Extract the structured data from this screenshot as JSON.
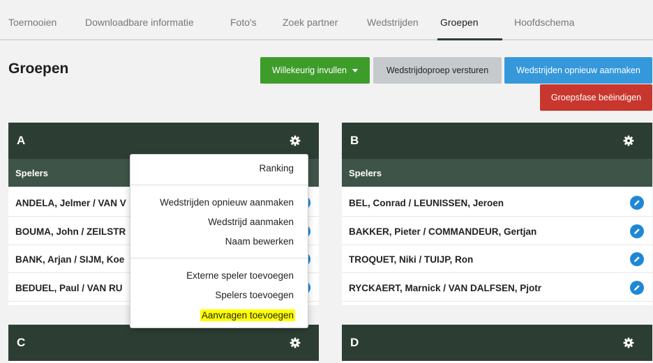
{
  "tabs": [
    {
      "label": "Toernooien"
    },
    {
      "label": "Downloadbare informatie"
    },
    {
      "label": "Foto's"
    },
    {
      "label": "Zoek partner"
    },
    {
      "label": "Wedstrijden"
    },
    {
      "label": "Groepen",
      "active": true
    },
    {
      "label": "Hoofdschema"
    }
  ],
  "page_title": "Groepen",
  "actions": {
    "random_fill": "Willekeurig invullen",
    "send_calls": "Wedstrijdoproep versturen",
    "recreate_matches": "Wedstrijden opnieuw aanmaken",
    "end_group_phase": "Groepsfase beëindigen"
  },
  "colors": {
    "dark_green": "#2c3e33",
    "green": "#3e9d2a",
    "blue": "#3598db",
    "red": "#c8372d",
    "grey": "#c6cacd",
    "highlight": "#ffff00"
  },
  "groups": [
    {
      "letter": "A",
      "players_header": "Spelers",
      "players": [
        "ANDELA, Jelmer / VAN V",
        "BOUMA, John / ZEILSTR",
        "BANK, Arjan / SIJM, Koe",
        "BEDUEL, Paul / VAN RU"
      ]
    },
    {
      "letter": "B",
      "players_header": "Spelers",
      "players": [
        "BEL, Conrad / LEUNISSEN, Jeroen",
        "BAKKER, Pieter / COMMANDEUR, Gertjan",
        "TROQUET, Niki / TUIJP, Ron",
        "RYCKAERT, Marnick / VAN DALFSEN, Pjotr"
      ]
    },
    {
      "letter": "C"
    },
    {
      "letter": "D"
    }
  ],
  "menu": {
    "ranking": "Ranking",
    "recreate_matches": "Wedstrijden opnieuw aanmaken",
    "create_match": "Wedstrijd aanmaken",
    "edit_name": "Naam bewerken",
    "add_external_player": "Externe speler toevoegen",
    "add_players": "Spelers toevoegen",
    "add_requests": "Aanvragen toevoegen"
  }
}
